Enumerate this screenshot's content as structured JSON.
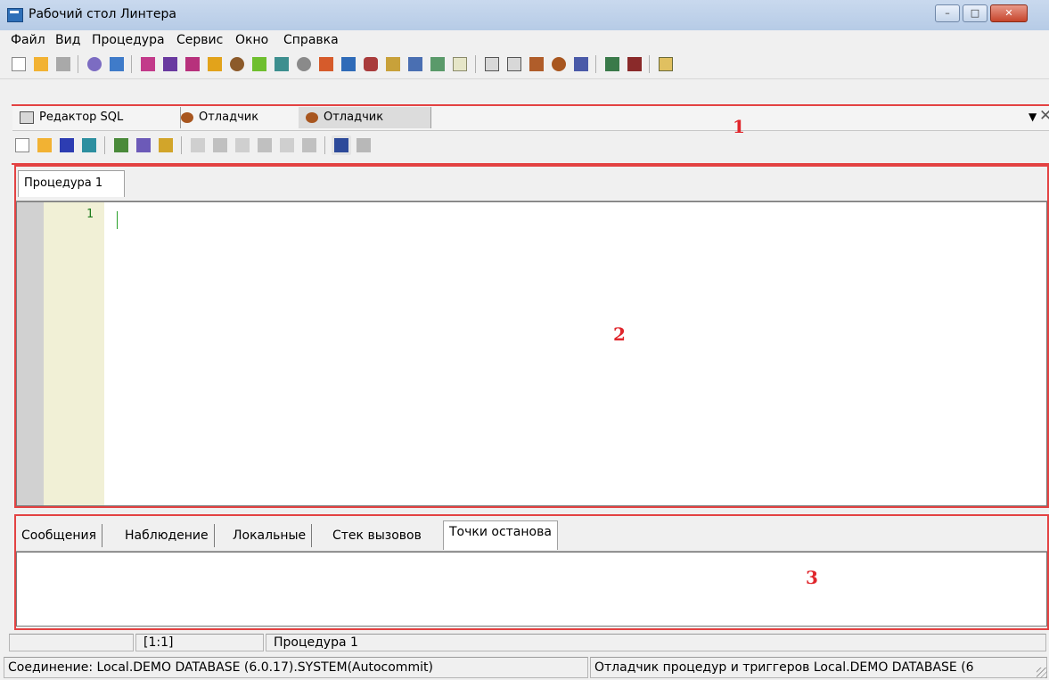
{
  "window": {
    "title": "Рабочий стол Линтера",
    "controls": [
      "minimize",
      "maximize",
      "close"
    ]
  },
  "menu": [
    "Файл",
    "Вид",
    "Процедура",
    "Сервис",
    "Окно",
    "Справка"
  ],
  "toolbar_main": [
    "new-file-icon",
    "open-folder-icon",
    "disabled-icon",
    "connect-icon",
    "disconnect-icon",
    "table-icon",
    "table-grid-icon",
    "table-edit-icon",
    "chart-icon",
    "users-icon",
    "draw-icon",
    "network-icon",
    "gear-icon",
    "tree-icon",
    "hierarchy-icon",
    "database-icon",
    "transfer-icon",
    "search-icon",
    "tools-icon",
    "calendar-icon",
    "sql-editor-icon",
    "sql-icon",
    "query-icon",
    "debugger-bug-icon",
    "hourglass-icon",
    "monitor-icon",
    "report-icon",
    "edit-icon"
  ],
  "doc_tabs": [
    {
      "label": "Редактор SQL",
      "icon": "sql-editor-icon"
    },
    {
      "label": "Отладчик",
      "icon": "debugger-bug-icon"
    },
    {
      "label": "Отладчик",
      "icon": "debugger-bug-icon",
      "active": true
    }
  ],
  "toolbar_debug": [
    "new-file-icon",
    "open-folder-icon",
    "save-icon",
    "save-as-icon",
    "compile-icon",
    "run-icon",
    "step-icon",
    "copy-icon",
    "paste-icon",
    "doc-icon",
    "doc-copy-icon",
    "doc-step-icon",
    "doc-cursor-icon",
    "glasses-icon",
    "page-icon"
  ],
  "markers": {
    "one": "1",
    "two": "2",
    "three": "3"
  },
  "procedure_tab": "Процедура 1",
  "editor": {
    "lines": [
      "1"
    ]
  },
  "bottom_tabs": [
    {
      "label": "Сообщения"
    },
    {
      "label": "Наблюдение"
    },
    {
      "label": "Локальные"
    },
    {
      "label": "Стек вызовов"
    },
    {
      "label": "Точки останова",
      "active": true
    }
  ],
  "status": {
    "position": "[1:1]",
    "procedure": "Процедура 1",
    "connection": "Соединение: Local.DEMO DATABASE (6.0.17).SYSTEM(Autocommit)",
    "debugger": "Отладчик процедур и триггеров Local.DEMO DATABASE (6"
  }
}
